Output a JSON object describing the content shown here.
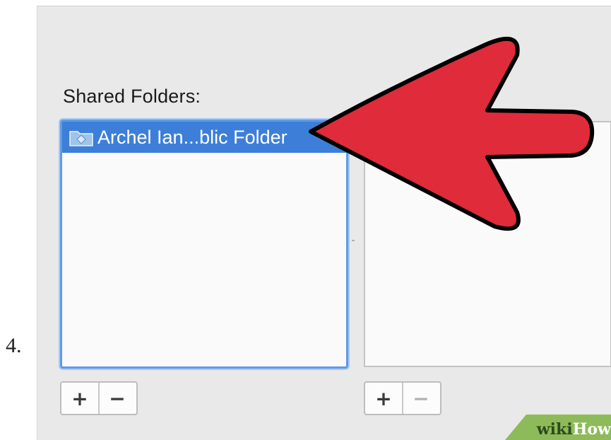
{
  "step": {
    "number": "4."
  },
  "shared_folders": {
    "label": "Shared Folders:",
    "items": [
      {
        "label": "Archel Ian...blic Folder",
        "icon": "shared-folder-icon",
        "selected": true
      }
    ],
    "add_label": "+",
    "remove_label": "−"
  },
  "users": {
    "add_label": "+",
    "remove_label": "−",
    "remove_disabled": true
  },
  "annotation": {
    "icon": "arrow-icon",
    "color": "#e02b3b"
  },
  "watermark": {
    "wiki": "wiki",
    "how": "How"
  },
  "colors": {
    "selection": "#3d7fd8",
    "focus_ring": "#5f9be6",
    "panel_bg": "#e9e9e9",
    "watermark_bg": "#8dbb5a"
  }
}
